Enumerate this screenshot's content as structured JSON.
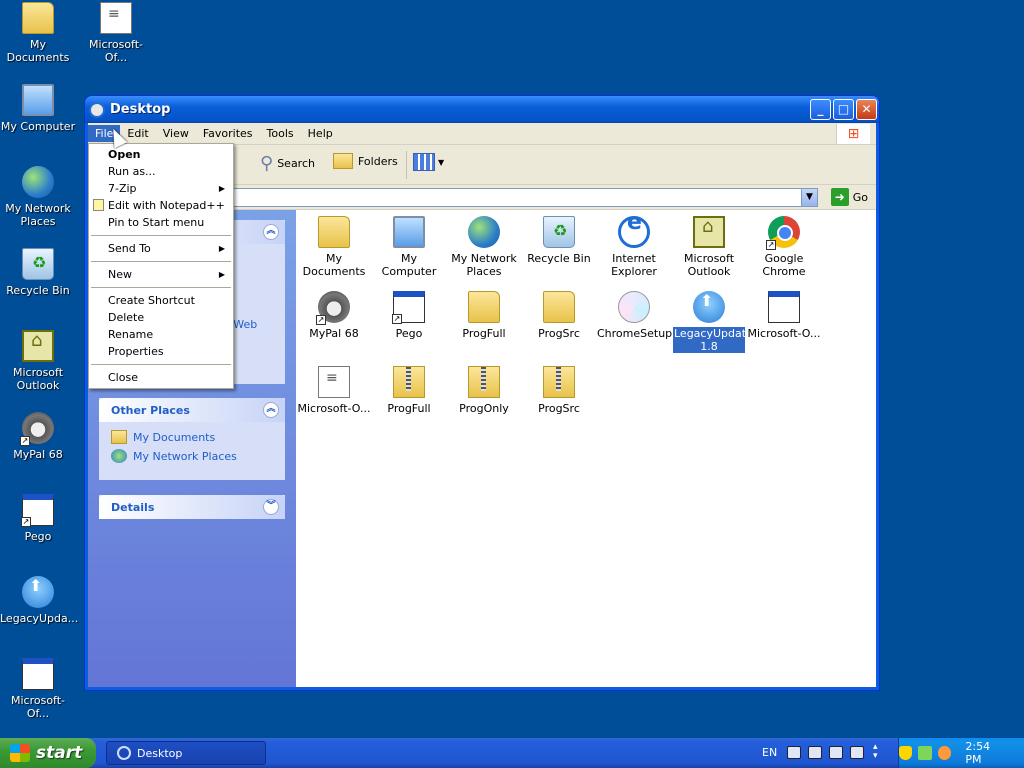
{
  "desktop": {
    "icons": [
      {
        "label": "My Documents",
        "icon": "folder-docs"
      },
      {
        "label": "Microsoft-Of...",
        "icon": "document"
      },
      {
        "label": "My Computer",
        "icon": "computer"
      },
      {
        "label": "My Network Places",
        "icon": "network"
      },
      {
        "label": "Recycle Bin",
        "icon": "recycle-bin"
      },
      {
        "label": "Microsoft Outlook",
        "icon": "outlook"
      },
      {
        "label": "MyPal 68",
        "icon": "mypal"
      },
      {
        "label": "Pego",
        "icon": "window-shortcut"
      },
      {
        "label": "LegacyUpda...",
        "icon": "legacy-update"
      },
      {
        "label": "Microsoft-Of...",
        "icon": "window-app"
      }
    ]
  },
  "window": {
    "title": "Desktop",
    "menubar": [
      "File",
      "Edit",
      "View",
      "Favorites",
      "Tools",
      "Help"
    ],
    "toolbar": {
      "search": "Search",
      "folders": "Folders"
    },
    "address_go": "Go",
    "tasks": {
      "web_fragment": "e Web",
      "other_places": {
        "title": "Other Places",
        "links": [
          "My Documents",
          "My Network Places"
        ]
      },
      "details": {
        "title": "Details"
      }
    },
    "files": [
      {
        "label": "My Documents",
        "icon": "folder-docs"
      },
      {
        "label": "My Computer",
        "icon": "computer"
      },
      {
        "label": "My Network Places",
        "icon": "network"
      },
      {
        "label": "Recycle Bin",
        "icon": "recycle-bin"
      },
      {
        "label": "Internet Explorer",
        "icon": "ie"
      },
      {
        "label": "Microsoft Outlook",
        "icon": "outlook"
      },
      {
        "label": "Google Chrome",
        "icon": "chrome"
      },
      {
        "label": "MyPal 68",
        "icon": "mypal"
      },
      {
        "label": "Pego",
        "icon": "window-shortcut"
      },
      {
        "label": "ProgFull",
        "icon": "folder"
      },
      {
        "label": "ProgSrc",
        "icon": "folder"
      },
      {
        "label": "ChromeSetup",
        "icon": "installer"
      },
      {
        "label": "LegacyUpdate-1.8",
        "icon": "legacy-update",
        "selected": true
      },
      {
        "label": "Microsoft-O...",
        "icon": "window-app"
      },
      {
        "label": "Microsoft-O...",
        "icon": "document"
      },
      {
        "label": "ProgFull",
        "icon": "zip-folder"
      },
      {
        "label": "ProgOnly",
        "icon": "zip-folder"
      },
      {
        "label": "ProgSrc",
        "icon": "zip-folder"
      }
    ]
  },
  "file_menu": {
    "items": [
      {
        "label": "Open",
        "bold": true
      },
      {
        "label": "Run as..."
      },
      {
        "label": "7-Zip",
        "submenu": true
      },
      {
        "label": "Edit with Notepad++"
      },
      {
        "label": "Pin to Start menu"
      },
      {
        "separator": true
      },
      {
        "label": "Send To",
        "submenu": true
      },
      {
        "separator": true
      },
      {
        "label": "New",
        "submenu": true
      },
      {
        "separator": true
      },
      {
        "label": "Create Shortcut"
      },
      {
        "label": "Delete"
      },
      {
        "label": "Rename"
      },
      {
        "label": "Properties"
      },
      {
        "separator": true
      },
      {
        "label": "Close"
      }
    ]
  },
  "taskbar": {
    "start": "start",
    "task_button": "Desktop",
    "language": "EN",
    "clock": "2:54 PM"
  },
  "colors": {
    "desktop_bg": "#004e98",
    "selection": "#316ac5",
    "link": "#215dc6"
  }
}
